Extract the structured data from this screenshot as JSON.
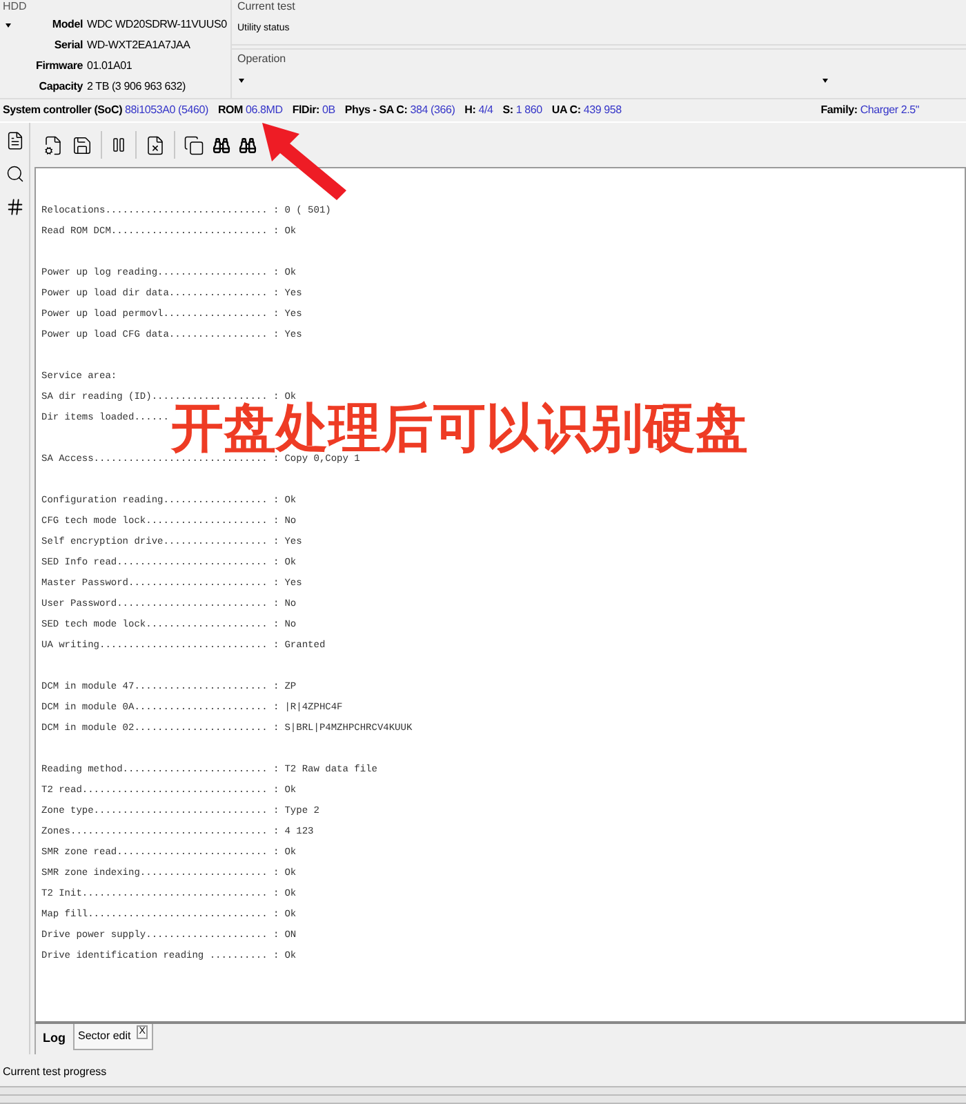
{
  "hdd": {
    "title": "HDD",
    "fields": [
      {
        "label": "Model",
        "value": "WDC WD20SDRW-11VUUS0"
      },
      {
        "label": "Serial",
        "value": "WD-WXT2EA1A7JAA"
      },
      {
        "label": "Firmware",
        "value": "01.01A01"
      },
      {
        "label": "Capacity",
        "value": "2 TB (3 906 963 632)"
      }
    ]
  },
  "current_test": {
    "title": "Current test",
    "value": "Utility status"
  },
  "operation": {
    "title": "Operation"
  },
  "status_bar": {
    "items": [
      {
        "label": "System controller (SoC)",
        "value": "88i1053A0 (5460)"
      },
      {
        "label": "ROM",
        "value": "06.8MD"
      },
      {
        "label": "FlDir:",
        "value": "0B"
      },
      {
        "label": "Phys - SA C:",
        "value": "384 (366)"
      },
      {
        "label": "H:",
        "value": "4/4"
      },
      {
        "label": "S:",
        "value": "1 860"
      },
      {
        "label": "UA C:",
        "value": "439 958"
      }
    ],
    "family": {
      "label": "Family:",
      "value": "Charger 2.5\""
    }
  },
  "log": {
    "groups": [
      [
        {
          "kind": "entry",
          "label": "Relocations............................ :",
          "value": "0 ( 501)"
        },
        {
          "kind": "entry",
          "label": "Read ROM DCM........................... :",
          "value": "Ok"
        }
      ],
      [
        {
          "kind": "entry",
          "label": "Power up log reading................... :",
          "value": "Ok"
        },
        {
          "kind": "entry",
          "label": "Power up load dir data................. :",
          "value": "Yes"
        },
        {
          "kind": "entry",
          "label": "Power up load permovl.................. :",
          "value": "Yes"
        },
        {
          "kind": "entry",
          "label": "Power up load CFG data................. :",
          "value": "Yes"
        }
      ],
      [
        {
          "kind": "heading",
          "label": "Service area:"
        },
        {
          "kind": "entry",
          "label": "SA dir reading (ID).................... :",
          "value": "Ok"
        },
        {
          "kind": "heading",
          "label": "Dir items loaded......"
        }
      ],
      [
        {
          "kind": "entry",
          "label": "SA Access.............................. :",
          "value": "Copy 0,Copy 1"
        }
      ],
      [
        {
          "kind": "entry",
          "label": "Configuration reading.................. :",
          "value": "Ok"
        },
        {
          "kind": "entry",
          "label": "CFG tech mode lock..................... :",
          "value": "No"
        },
        {
          "kind": "entry",
          "label": "Self encryption drive.................. :",
          "value": "Yes"
        },
        {
          "kind": "entry",
          "label": "SED Info read.......................... :",
          "value": "Ok"
        },
        {
          "kind": "entry",
          "label": "Master Password........................ :",
          "value": "Yes"
        },
        {
          "kind": "entry",
          "label": "User Password.......................... :",
          "value": "No"
        },
        {
          "kind": "entry",
          "label": "SED tech mode lock..................... :",
          "value": "No"
        },
        {
          "kind": "entry",
          "label": "UA writing............................. :",
          "value": "Granted"
        }
      ],
      [
        {
          "kind": "entry",
          "label": "DCM in module 47....................... :",
          "value": "ZP"
        },
        {
          "kind": "entry",
          "label": "DCM in module 0A....................... :",
          "value": "|R|4ZPHC4F"
        },
        {
          "kind": "entry",
          "label": "DCM in module 02....................... :",
          "value": "S|BRL|P4MZHPCHRCV4KUUK"
        }
      ],
      [
        {
          "kind": "entry",
          "label": "Reading method......................... :",
          "value": "T2 Raw data file"
        },
        {
          "kind": "entry",
          "label": "T2 read................................ :",
          "value": "Ok"
        },
        {
          "kind": "entry",
          "label": "Zone type.............................. :",
          "value": "Type 2"
        },
        {
          "kind": "entry",
          "label": "Zones.................................. :",
          "value": "4 123"
        },
        {
          "kind": "entry",
          "label": "SMR zone read.......................... :",
          "value": "Ok"
        },
        {
          "kind": "entry",
          "label": "SMR zone indexing...................... :",
          "value": "Ok"
        },
        {
          "kind": "entry",
          "label": "T2 Init................................ :",
          "value": "Ok"
        },
        {
          "kind": "entry",
          "label": "Map fill............................... :",
          "value": "Ok"
        },
        {
          "kind": "entry",
          "label": "Drive power supply..................... :",
          "value": "ON"
        },
        {
          "kind": "entry",
          "label": "Drive identification reading .......... :",
          "value": "Ok"
        }
      ]
    ]
  },
  "tabs": [
    {
      "label": "Log",
      "selected": true,
      "closable": false
    },
    {
      "label": "Sector edit",
      "selected": false,
      "closable": true,
      "close": "X"
    }
  ],
  "progress": {
    "label": "Current test progress"
  },
  "annotation": {
    "caption": "开盘处理后可以识别硬盘"
  }
}
